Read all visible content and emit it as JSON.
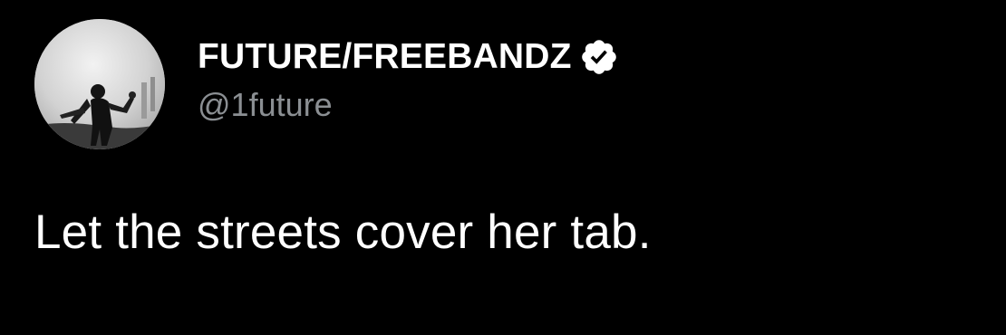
{
  "tweet": {
    "author": {
      "display_name": "FUTURE/FREEBANDZ",
      "handle": "@1future",
      "verified": true,
      "avatar_icon": "profile-photo"
    },
    "text": "Let the streets cover her tab."
  },
  "colors": {
    "background": "#000000",
    "name": "#ffffff",
    "handle": "#8b8f93",
    "text": "#ffffff",
    "verified_badge": "#ffffff"
  }
}
